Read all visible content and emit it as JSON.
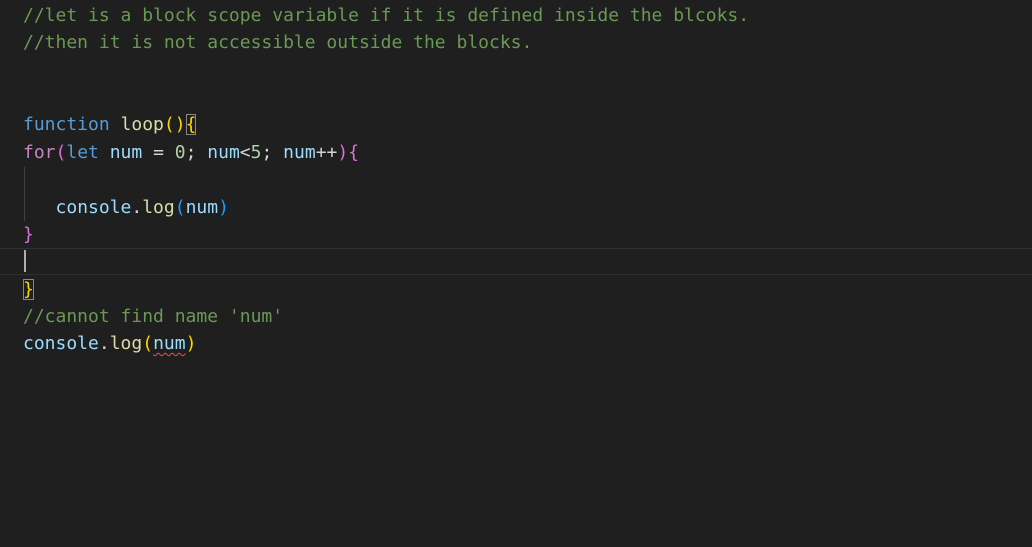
{
  "code": {
    "l1": "//let is a block scope variable if it is defined inside the blcoks.",
    "l2": "//then it is not accessible outside the blocks.",
    "l5_kw": "function",
    "l5_fn": "loop",
    "l5_paren": "()",
    "l5_brace": "{",
    "l6_for": "for",
    "l6_open": "(",
    "l6_let": "let",
    "l6_var1": "num",
    "l6_eq": " = ",
    "l6_zero": "0",
    "l6_semi1": "; ",
    "l6_var2": "num",
    "l6_lt": "<",
    "l6_five": "5",
    "l6_semi2": "; ",
    "l6_var3": "num",
    "l6_inc": "++",
    "l6_close": ")",
    "l6_brace": "{",
    "l8_indent": "   ",
    "l8_obj": "console",
    "l8_dot": ".",
    "l8_fn": "log",
    "l8_open": "(",
    "l8_arg": "num",
    "l8_close": ")",
    "l9_brace": "}",
    "l11_brace": "}",
    "l12": "//cannot find name 'num'",
    "l13_obj": "console",
    "l13_dot": ".",
    "l13_fn": "log",
    "l13_open": "(",
    "l13_arg": "num",
    "l13_close": ")"
  },
  "colors": {
    "background": "#1f1f1f",
    "comment": "#6a9955",
    "keyword": "#569cd6",
    "control_keyword": "#c586c0",
    "function": "#dcdcaa",
    "variable": "#9cdcfe",
    "number": "#b5cea8",
    "bracket_level1": "#ffd700",
    "bracket_level2": "#da70d6",
    "bracket_level3": "#179fff",
    "error_squiggle": "#f14c4c"
  }
}
